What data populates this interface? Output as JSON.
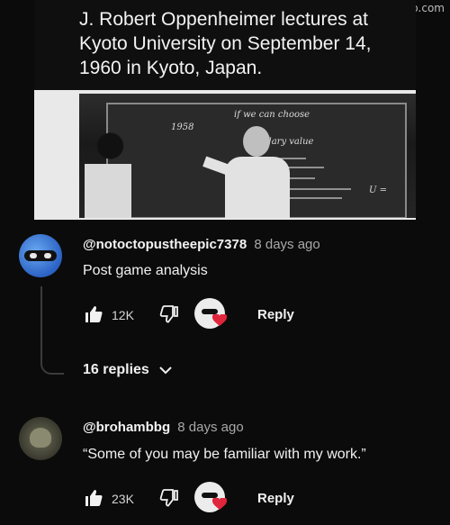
{
  "watermark": "imgflip.com",
  "post": {
    "caption": "J. Robert Oppenheimer lectures at Kyoto University on September 14, 1960 in Kyoto, Japan.",
    "blackboard": {
      "line1": "if we can choose",
      "line2": "1958",
      "line3": "boundary value",
      "line4": "U ="
    }
  },
  "comments": [
    {
      "author": "@notoctopustheepic7378",
      "time": "8 days ago",
      "text": "Post game analysis",
      "likes": "12K",
      "reply_label": "Reply",
      "replies_label": "16 replies"
    },
    {
      "author": "@brohambbg",
      "time": "8 days ago",
      "text": "“Some of you may be familiar with my work.”",
      "likes": "23K",
      "reply_label": "Reply"
    }
  ],
  "icons": {
    "like": "thumb-up-icon",
    "dislike": "thumb-down-icon",
    "creator_heart": "creator-heart-icon",
    "expand": "chevron-down-icon"
  },
  "colors": {
    "background": "#0b0b0b",
    "heart": "#e0263c",
    "secondary_text": "#a8a8a8"
  }
}
